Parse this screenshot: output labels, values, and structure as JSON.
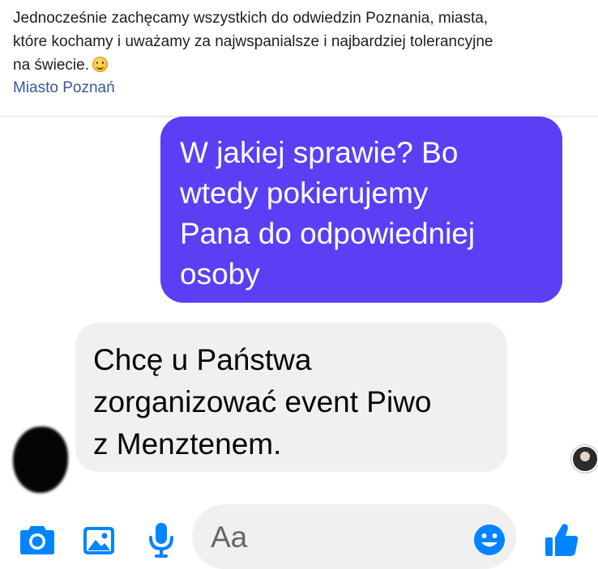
{
  "post": {
    "text_line1": "Jednocześnie zachęcamy wszystkich do odwiedzin Poznania, miasta,",
    "text_line2": "które kochamy i uważamy za najwspanialsze i najbardziej tolerancyjne",
    "text_line3": "na świecie.",
    "link": "Miasto Poznań"
  },
  "chat": {
    "outgoing": {
      "line1": "W jakiej sprawie? Bo",
      "line2": "wtedy pokierujemy",
      "line3": "Pana do odpowiedniej",
      "line4": "osoby"
    },
    "incoming": {
      "line1": "Chcę u Państwa",
      "line2": "zorganizować event Piwo",
      "line3": "z Menztenem."
    }
  },
  "composer": {
    "placeholder": "Aa",
    "icons": [
      "camera-icon",
      "image-icon",
      "microphone-icon",
      "emoji-icon",
      "thumbs-up-icon"
    ],
    "accent_color": "#0084ff"
  },
  "colors": {
    "outgoing_bubble": "#5b3ff5",
    "incoming_bubble": "#f0f0f0",
    "link": "#385898"
  }
}
